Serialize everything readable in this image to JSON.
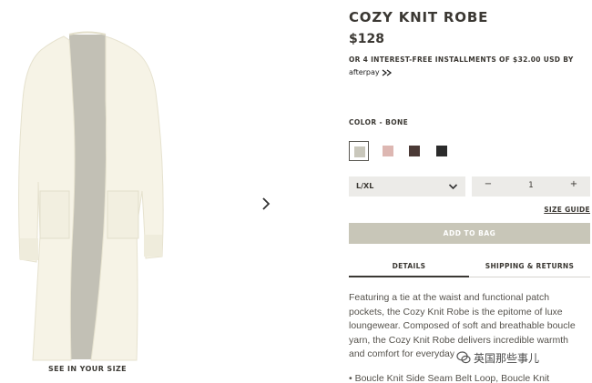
{
  "product": {
    "title": "COZY KNIT ROBE",
    "price": "$128",
    "installments": "OR 4 INTEREST-FREE INSTALLMENTS OF $32.00 USD BY",
    "afterpay_logo": "afterpay",
    "color_label": "COLOR - BONE",
    "swatches": [
      {
        "name": "bone",
        "color": "#c9c7bb",
        "selected": true
      },
      {
        "name": "pink",
        "color": "#ddb7b2",
        "selected": false
      },
      {
        "name": "brown",
        "color": "#4b3a36",
        "selected": false
      },
      {
        "name": "black",
        "color": "#2b2b2b",
        "selected": false
      }
    ],
    "size_value": "L/XL",
    "quantity": {
      "minus": "−",
      "value": "1",
      "plus": "+"
    },
    "size_guide": "SIZE GUIDE",
    "add_to_bag": "ADD TO BAG",
    "tabs": [
      {
        "label": "DETAILS",
        "active": true
      },
      {
        "label": "SHIPPING & RETURNS",
        "active": false
      }
    ],
    "description_lines": [
      "Featuring a tie at the waist and functional patch",
      "pockets, the Cozy Knit Robe is the epitome of luxe",
      "loungewear. Composed of soft and breathable boucle",
      "yarn, the Cozy Knit Robe delivers incredible warmth",
      "and comfort for everyday"
    ],
    "bullet": "• Boucle Knit Side Seam Belt Loop, Boucle Knit"
  },
  "image": {
    "see_in_your_size": "SEE IN YOUR SIZE",
    "next_icon": "chevron-right-icon"
  },
  "watermark": {
    "text": "英国那些事儿",
    "icon": "wechat-icon"
  },
  "colors": {
    "text": "#3b3833",
    "button": "#c8c6b8",
    "field": "#ecebe8",
    "robe": "#f6f3e6",
    "lining": "#c2c0b5"
  }
}
